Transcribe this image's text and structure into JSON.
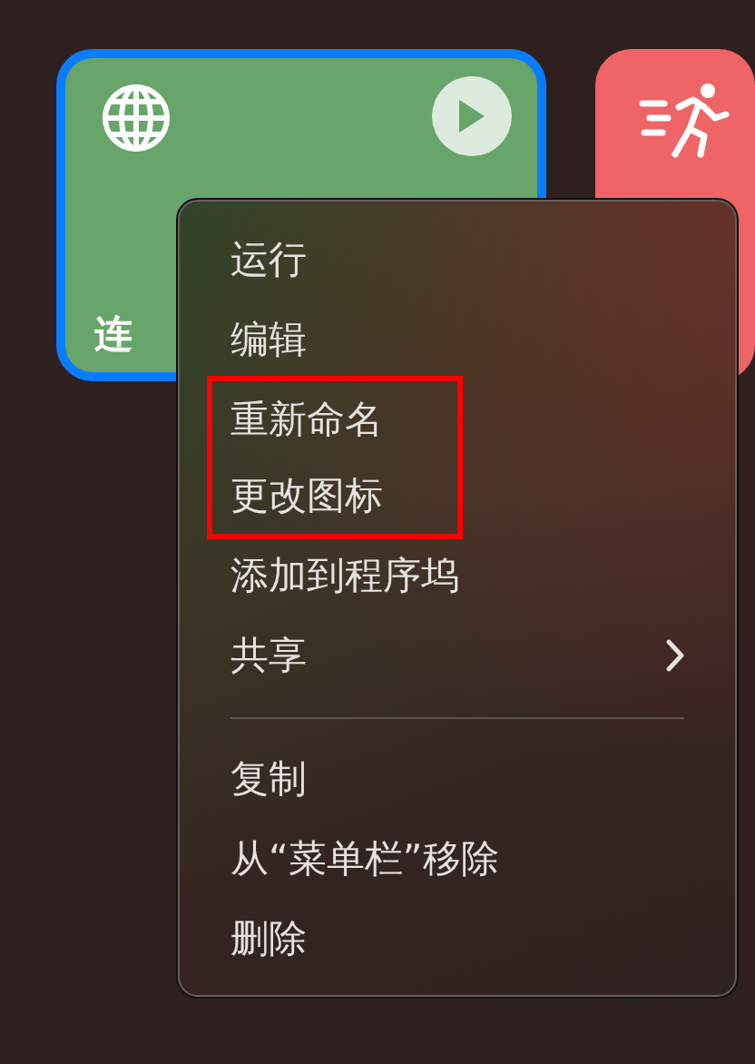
{
  "shortcuts": [
    {
      "title": "连",
      "color": "#67a56a",
      "selected": true,
      "play_button": true
    },
    {
      "color": "#ee6467",
      "selected": false,
      "play_button": false
    }
  ],
  "context_menu": {
    "sections": [
      {
        "items": [
          {
            "label": "运行",
            "highlighted": false,
            "submenu": false
          },
          {
            "label": "编辑",
            "highlighted": false,
            "submenu": false
          },
          {
            "label": "重新命名",
            "highlighted": true,
            "submenu": false
          },
          {
            "label": "更改图标",
            "highlighted": true,
            "submenu": false
          },
          {
            "label": "添加到程序坞",
            "highlighted": false,
            "submenu": false
          },
          {
            "label": "共享",
            "highlighted": false,
            "submenu": true
          }
        ]
      },
      {
        "items": [
          {
            "label": "复制",
            "highlighted": false,
            "submenu": false
          },
          {
            "label": "从“菜单栏”移除",
            "highlighted": false,
            "submenu": false
          },
          {
            "label": "删除",
            "highlighted": false,
            "submenu": false
          }
        ]
      }
    ]
  }
}
